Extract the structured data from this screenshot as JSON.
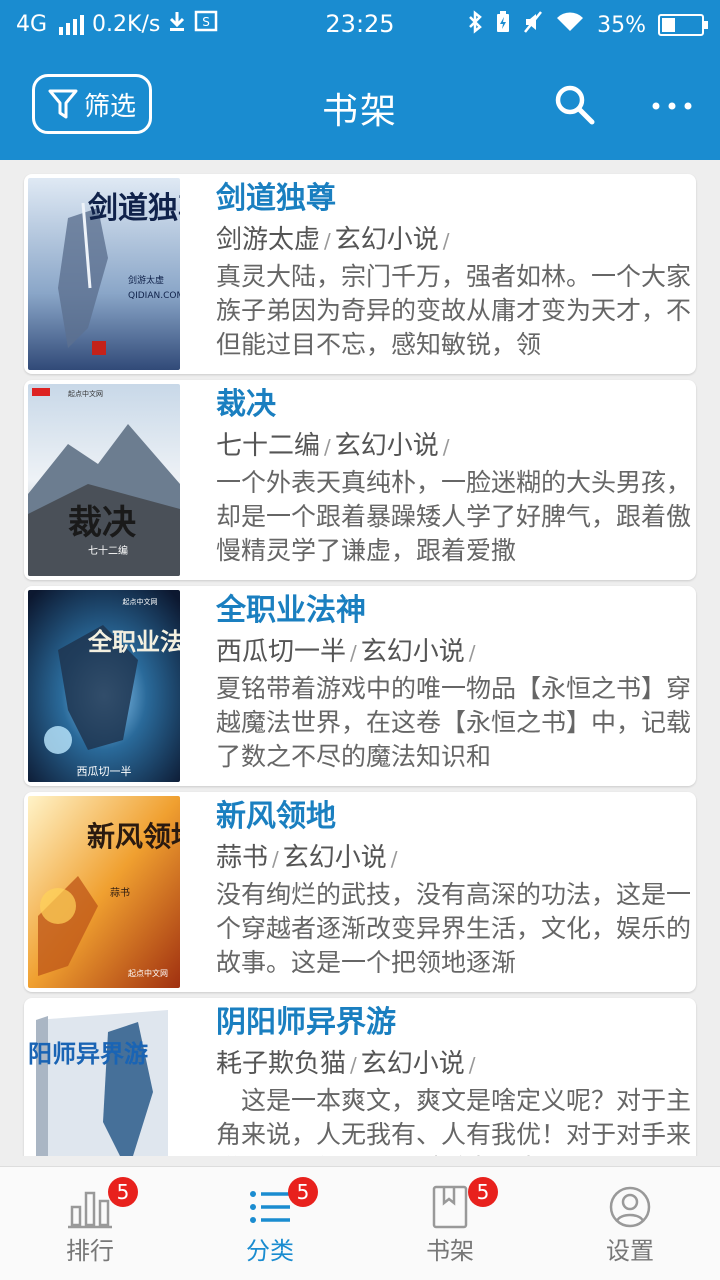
{
  "status_bar": {
    "network": "4G",
    "speed": "0.2K/s",
    "time": "23:25",
    "battery": "35%",
    "battery_level": 0.35,
    "icons": [
      "signal-icon",
      "download-icon",
      "screenshot-icon",
      "bluetooth-icon",
      "battery-saver-icon",
      "mute-icon",
      "wifi-icon",
      "battery-icon"
    ]
  },
  "app_bar": {
    "filter_label": "筛选",
    "title": "书架",
    "icons": [
      "filter-icon",
      "search-icon",
      "more-icon"
    ],
    "color": "#1a8cd0"
  },
  "books": [
    {
      "title": "剑道独尊",
      "author": "剑游太虚",
      "category": "玄幻小说",
      "separator": "/",
      "description": "真灵大陆，宗门千万，强者如林。一个大家族子弟因为奇异的变故从庸才变为天才，不但能过目不忘，感知敏锐，领"
    },
    {
      "title": "裁决",
      "author": "七十二编",
      "category": "玄幻小说",
      "separator": "/",
      "description": "一个外表天真纯朴，一脸迷糊的大头男孩，却是一个跟着暴躁矮人学了好脾气，跟着傲慢精灵学了谦虚，跟着爱撒"
    },
    {
      "title": "全职业法神",
      "author": "西瓜切一半",
      "category": "玄幻小说",
      "separator": "/",
      "description": "夏铭带着游戏中的唯一物品【永恒之书】穿越魔法世界，在这卷【永恒之书】中，记载了数之不尽的魔法知识和"
    },
    {
      "title": "新风领地",
      "author": "蒜书",
      "category": "玄幻小说",
      "separator": "/",
      "description": "没有绚烂的武技，没有高深的功法，这是一个穿越者逐渐改变异界生活，文化，娱乐的故事。这是一个把领地逐渐"
    },
    {
      "title": "阴阳师异界游",
      "author": "耗子欺负猫",
      "category": "玄幻小说",
      "separator": "/",
      "description": "　这是一本爽文，爽文是啥定义呢？对于主角来说，人无我有、人有我优！对于对手来说，我死得不冤，对手太强大了"
    }
  ],
  "covers": {
    "book1_text": "剑道独尊",
    "book1_author": "剑游太虚",
    "book1_site": "QIDIAN.COM",
    "book2_site": "起点中文网",
    "book2_text": "裁决",
    "book2_author": "七十二编",
    "book3_text": "全职业法神",
    "book3_site": "起点中文网",
    "book3_author": "西瓜切一半",
    "book4_text": "新风领地",
    "book4_author": "蒜书",
    "book4_site": "起点中文网",
    "book5_text": "阴阳师异界游"
  },
  "bottom_nav": [
    {
      "label": "排行",
      "badge": "5",
      "icon": "ranking-icon",
      "active": false
    },
    {
      "label": "分类",
      "badge": "5",
      "icon": "category-icon",
      "active": true
    },
    {
      "label": "书架",
      "badge": "5",
      "icon": "bookshelf-icon",
      "active": false
    },
    {
      "label": "设置",
      "badge": "",
      "icon": "settings-icon",
      "active": false
    }
  ],
  "colors": {
    "primary": "#1a8cd0",
    "title_text": "#1a7fc0",
    "badge": "#e8211d",
    "background": "#eeeeee"
  }
}
